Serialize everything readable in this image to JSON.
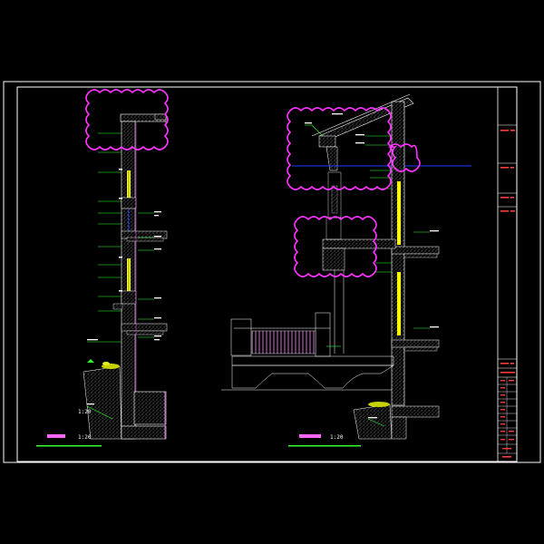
{
  "drawing": {
    "left_section": {
      "scale": "1:20"
    },
    "right_section": {
      "scale": "1:20"
    },
    "left_annotation": {
      "scale": "1:20"
    }
  },
  "title_block": {
    "rows": [
      "",
      "",
      "",
      "",
      "",
      "",
      "",
      "",
      "",
      ""
    ]
  },
  "colors": {
    "background": "#000000",
    "frame": "#ffffff",
    "revision_cloud": "#ff33ff",
    "annotation_line": "#33ff33",
    "glass": "#ffff00",
    "axis_line": "#1e3cff",
    "concrete_hatch": "#bfbfbf",
    "title_text": "#ff3b3b"
  }
}
